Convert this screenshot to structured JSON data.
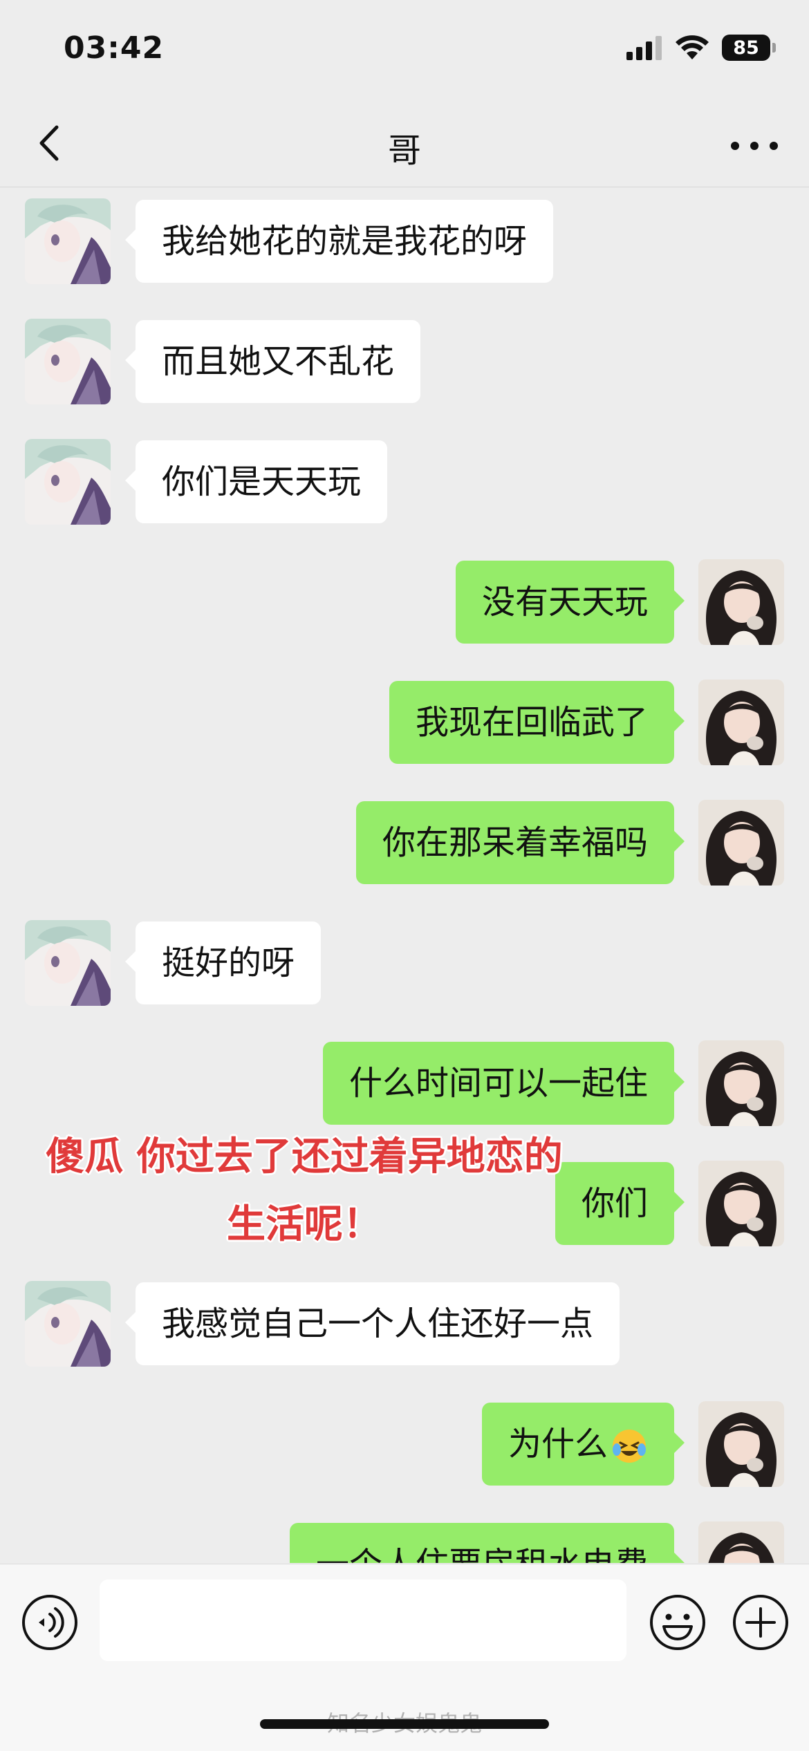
{
  "status_bar": {
    "time": "03:42",
    "battery": "85"
  },
  "header": {
    "title": "哥"
  },
  "messages": [
    {
      "side": "left",
      "text": "我给她花的就是我花的呀"
    },
    {
      "side": "left",
      "text": "而且她又不乱花"
    },
    {
      "side": "left",
      "text": "你们是天天玩"
    },
    {
      "side": "right",
      "text": "没有天天玩"
    },
    {
      "side": "right",
      "text": "我现在回临武了"
    },
    {
      "side": "right",
      "text": "你在那呆着幸福吗"
    },
    {
      "side": "left",
      "text": "挺好的呀"
    },
    {
      "side": "right",
      "text": "什么时间可以一起住"
    },
    {
      "side": "right",
      "text": "你们"
    },
    {
      "side": "left",
      "text": "我感觉自己一个人住还好一点"
    },
    {
      "side": "right",
      "text": "为什么",
      "emoji": "laughing-crying-emoji"
    },
    {
      "side": "right",
      "text": "一个人住要房租水电费"
    }
  ],
  "overlay_caption": {
    "line1": "傻瓜 你过去了还过着异地恋的",
    "line2": "生活呢！"
  },
  "input_bar": {
    "placeholder": ""
  },
  "watermark": "知名少女娱鬼鬼",
  "colors": {
    "background": "#ededed",
    "sent_bubble": "#95ec69",
    "received_bubble": "#ffffff",
    "caption": "#e03a3a"
  }
}
